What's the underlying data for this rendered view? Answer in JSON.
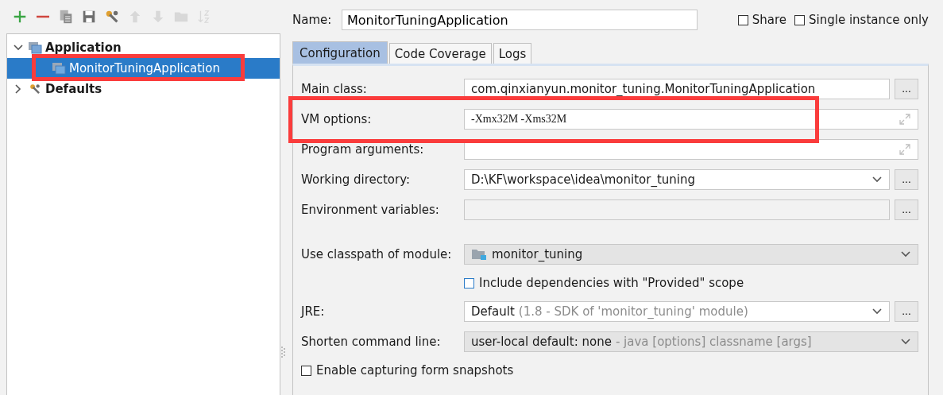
{
  "toolbar": [
    {
      "kind": "add",
      "disabled": false
    },
    {
      "kind": "remove",
      "disabled": false
    },
    {
      "kind": "copy",
      "disabled": false
    },
    {
      "kind": "save",
      "disabled": false
    },
    {
      "kind": "wrench",
      "disabled": false
    },
    {
      "kind": "up",
      "disabled": true
    },
    {
      "kind": "down",
      "disabled": true
    },
    {
      "kind": "folder",
      "disabled": true
    },
    {
      "kind": "sort",
      "disabled": true
    }
  ],
  "tree": [
    {
      "label": "Application",
      "kind": "app",
      "expanded": true,
      "selected": false,
      "children": [
        {
          "label": "MonitorTuningApplication",
          "kind": "app",
          "selected": true
        }
      ]
    },
    {
      "label": "Defaults",
      "kind": "wrench",
      "expanded": false,
      "selected": false
    }
  ],
  "name": {
    "label": "Name:",
    "value": "MonitorTuningApplication"
  },
  "options": [
    {
      "label": "Share",
      "checked": false
    },
    {
      "label": "Single instance only",
      "checked": false
    }
  ],
  "tabs": [
    {
      "label": "Configuration",
      "selected": true
    },
    {
      "label": "Code Coverage",
      "selected": false
    },
    {
      "label": "Logs",
      "selected": false
    }
  ],
  "rows": [
    {
      "kind": "text",
      "label": "Main class:",
      "value": "com.qinxianyun.monitor_tuning.MonitorTuningApplication",
      "browse": "..."
    },
    {
      "kind": "expand",
      "label": "VM options:",
      "value": "-Xmx32M -Xms32M",
      "mono": true
    },
    {
      "kind": "expand",
      "label": "Program arguments:"
    },
    {
      "kind": "combo",
      "label": "Working directory:",
      "value": "D:\\KF\\workspace\\idea\\monitor_tuning",
      "browse": "..."
    },
    {
      "kind": "text",
      "label": "Environment variables:",
      "disabled": true,
      "browse": "..."
    },
    {
      "kind": "spacer"
    },
    {
      "kind": "module",
      "label": "Use classpath of module:",
      "value": "monitor_tuning"
    },
    {
      "kind": "checkbox",
      "label": "Include dependencies with \"Provided\" scope",
      "checked": false,
      "indent": true
    },
    {
      "kind": "combo",
      "label": "JRE:",
      "value": "Default",
      "hint": "(1.8 - SDK of 'monitor_tuning' module)",
      "browse": "..."
    },
    {
      "kind": "select",
      "label": "Shorten command line:",
      "value": "user-local default: none",
      "hint": "- java [options] classname [args]"
    },
    {
      "kind": "checkbox",
      "label": "Enable capturing form snapshots",
      "checked": false
    }
  ]
}
